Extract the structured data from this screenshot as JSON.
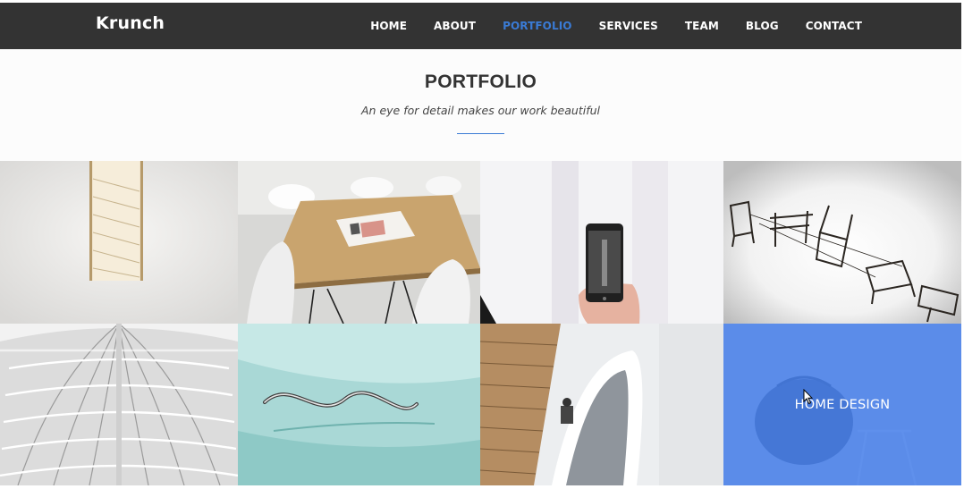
{
  "brand": {
    "logo_text": "Krunch"
  },
  "nav": {
    "items": [
      {
        "label": "HOME",
        "active": false
      },
      {
        "label": "ABOUT",
        "active": false
      },
      {
        "label": "PORTFOLIO",
        "active": true
      },
      {
        "label": "SERVICES",
        "active": false
      },
      {
        "label": "TEAM",
        "active": false
      },
      {
        "label": "BLOG",
        "active": false
      },
      {
        "label": "CONTACT",
        "active": false
      }
    ]
  },
  "portfolio": {
    "title": "PORTFOLIO",
    "subtitle": "An eye for detail makes our work beautiful",
    "hover_item_title": "HOME DESIGN"
  },
  "colors": {
    "accent": "#3a7bd5",
    "navbar_bg": "#333333",
    "overlay": "#4880ea"
  }
}
